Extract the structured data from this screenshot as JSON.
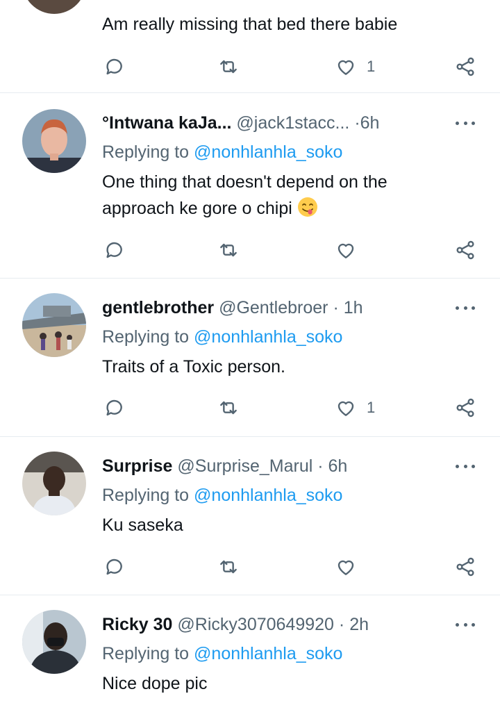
{
  "tweets": [
    {
      "text": "Am really missing that bed there babie",
      "likes": "1"
    },
    {
      "name": "°Intwana kaJa...",
      "handle": "@jack1stacc...",
      "dot": "·",
      "time": "6h",
      "replying_label": "Replying to",
      "mention": "@nonhlanhla_soko",
      "text_line1": "One thing that doesn't depend on the",
      "text_line2": "approach ke gore o chipi",
      "emoji": "😋",
      "likes": ""
    },
    {
      "name": "gentlebrother",
      "handle": "@Gentlebroer",
      "dot": "·",
      "time": "1h",
      "replying_label": "Replying to",
      "mention": "@nonhlanhla_soko",
      "text": "Traits of a Toxic person.",
      "likes": "1"
    },
    {
      "name": "Surprise",
      "handle": "@Surprise_Marul",
      "dot": "·",
      "time": "6h",
      "replying_label": "Replying to",
      "mention": "@nonhlanhla_soko",
      "text": "Ku saseka",
      "likes": ""
    },
    {
      "name": "Ricky 30",
      "handle": "@Ricky3070649920",
      "dot": "·",
      "time": "2h",
      "replying_label": "Replying to",
      "mention": "@nonhlanhla_soko",
      "text": "Nice dope pic"
    }
  ],
  "icons": {
    "reply": "reply-icon",
    "retweet": "retweet-icon",
    "like": "heart-icon",
    "share": "share-icon",
    "more": "more-icon"
  },
  "colors": {
    "text": "#0f1419",
    "secondary": "#536471",
    "mention": "#1d9bf0",
    "divider": "#e6ecf0"
  }
}
